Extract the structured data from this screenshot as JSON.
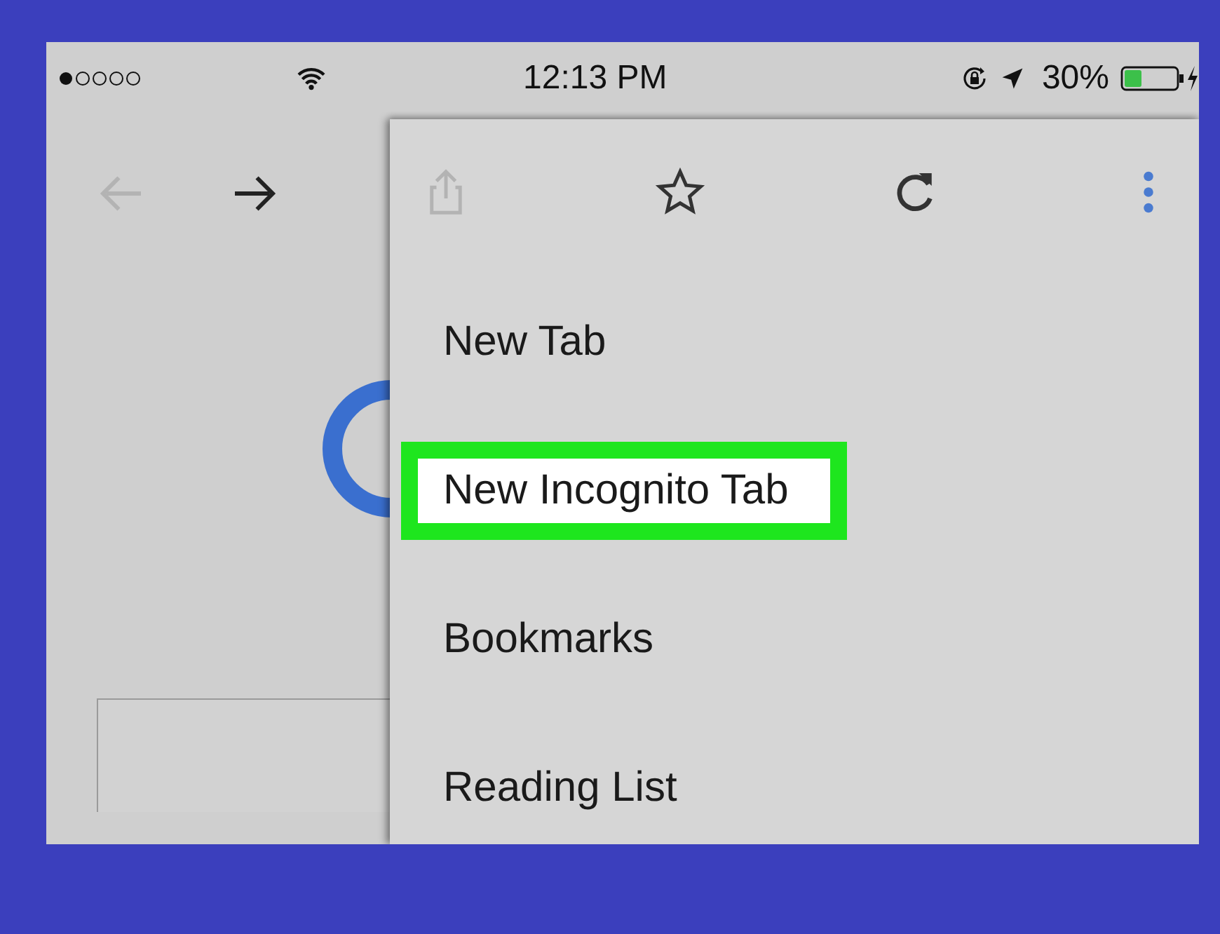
{
  "status_bar": {
    "time": "12:13 PM",
    "battery": "30%"
  },
  "browser_nav": [
    {
      "kind": "back",
      "disabled": true
    },
    {
      "kind": "forward",
      "disabled": false
    }
  ],
  "menu": {
    "toolbar": [
      {
        "kind": "share",
        "disabled": true
      },
      {
        "kind": "star",
        "disabled": false
      },
      {
        "kind": "reload",
        "disabled": false
      },
      {
        "kind": "more",
        "disabled": false
      }
    ],
    "items": [
      {
        "label": "New Tab",
        "selected": false
      },
      {
        "label": "New Incognito Tab",
        "selected": true
      },
      {
        "label": "Bookmarks",
        "selected": false
      },
      {
        "label": "Reading List",
        "selected": false
      }
    ]
  }
}
